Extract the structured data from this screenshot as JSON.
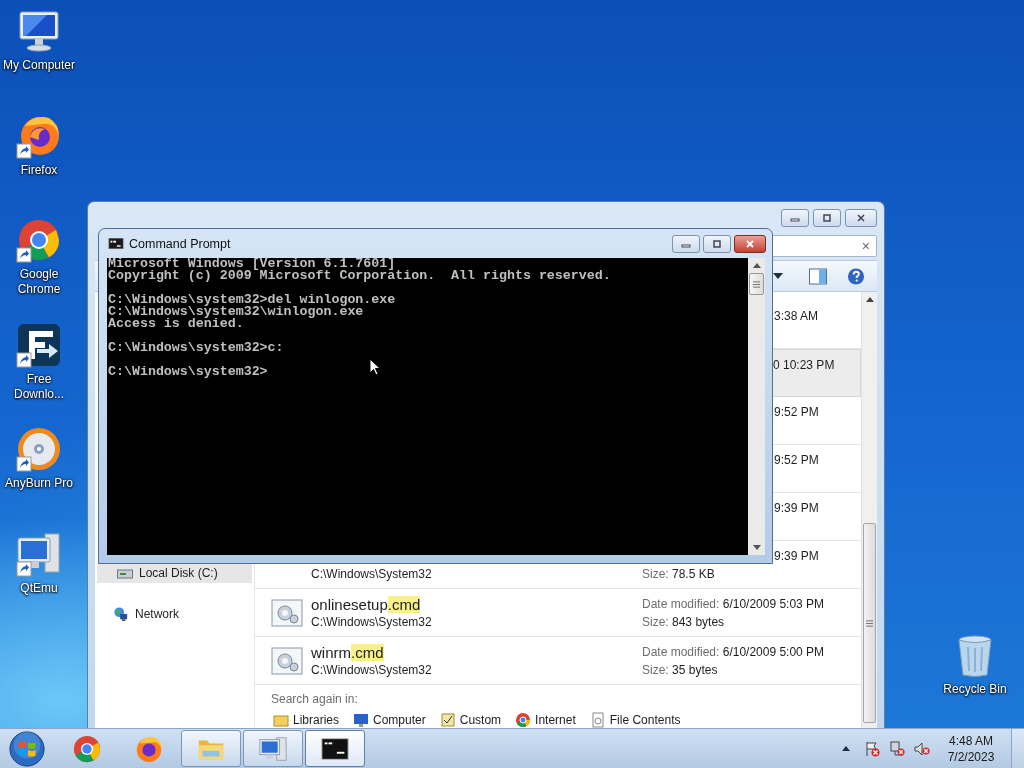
{
  "desktop_icons": [
    {
      "label": "My Computer",
      "kind": "computer",
      "shortcut": false
    },
    {
      "label": "Firefox",
      "kind": "firefox",
      "shortcut": true
    },
    {
      "label": "Google Chrome",
      "kind": "chrome",
      "shortcut": true
    },
    {
      "label": "Free Downlo...",
      "kind": "download",
      "shortcut": true
    },
    {
      "label": "AnyBurn Pro",
      "kind": "burn",
      "shortcut": true
    },
    {
      "label": "QtEmu",
      "kind": "emulator",
      "shortcut": true
    }
  ],
  "desktop_icons_right": [
    {
      "label": "Recycle Bin",
      "kind": "recycle",
      "shortcut": false
    }
  ],
  "explorer": {
    "search_clear": "×",
    "nav": [
      {
        "label": "Local Disk (C:)",
        "kind": "drive",
        "selected": true
      },
      {
        "label": "Network",
        "kind": "network",
        "selected": false
      }
    ],
    "results": [
      {
        "kind": "partial",
        "date_tail": "3:38 AM",
        "selected": false
      },
      {
        "kind": "partial",
        "date_tail": "0 10:23 PM",
        "selected": true
      },
      {
        "kind": "partial",
        "date_tail": "9:52 PM",
        "selected": false
      },
      {
        "kind": "partial",
        "date_tail": "9:52 PM",
        "selected": false
      },
      {
        "kind": "partial",
        "date_tail": "9:39 PM",
        "selected": false
      },
      {
        "kind": "partial",
        "date_tail": "9:39 PM",
        "path": "C:\\Windows\\System32",
        "size_label": "Size:",
        "size": "78.5 KB",
        "selected": false
      },
      {
        "kind": "full",
        "name": "onlinesetup",
        "match": ".cmd",
        "path": "C:\\Windows\\System32",
        "date_label": "Date modified:",
        "date": "6/10/2009 5:03 PM",
        "size_label": "Size:",
        "size": "843 bytes",
        "selected": false
      },
      {
        "kind": "full",
        "name": "winrm",
        "match": ".cmd",
        "path": "C:\\Windows\\System32",
        "date_label": "Date modified:",
        "date": "6/10/2009 5:00 PM",
        "size_label": "Size:",
        "size": "35 bytes",
        "selected": false
      }
    ],
    "search_again": {
      "label": "Search again in:",
      "options": [
        {
          "label": "Libraries",
          "kind": "libraries"
        },
        {
          "label": "Computer",
          "kind": "computer"
        },
        {
          "label": "Custom",
          "kind": "custom"
        },
        {
          "label": "Internet",
          "kind": "internet"
        },
        {
          "label": "File Contents",
          "kind": "contents"
        }
      ]
    }
  },
  "cmd": {
    "title": "Command Prompt",
    "blocks": [
      [
        "Microsoft Windows [Version 6.1.7601]",
        "Copyright (c) 2009 Microsoft Corporation.  All rights reserved."
      ],
      [
        "C:\\Windows\\system32>del winlogon.exe",
        "C:\\Windows\\system32\\winlogon.exe",
        "Access is denied."
      ],
      [
        "C:\\Windows\\system32>c:"
      ],
      [
        "C:\\Windows\\system32>"
      ]
    ]
  },
  "taskbar": {
    "items": [
      {
        "kind": "chrome",
        "running": false,
        "active": false
      },
      {
        "kind": "firefox",
        "running": false,
        "active": false
      },
      {
        "kind": "folder",
        "running": true,
        "active": false
      },
      {
        "kind": "emulator",
        "running": true,
        "active": false
      },
      {
        "kind": "console",
        "running": true,
        "active": true
      }
    ],
    "clock": {
      "time": "4:48 AM",
      "date": "7/2/2023"
    }
  }
}
